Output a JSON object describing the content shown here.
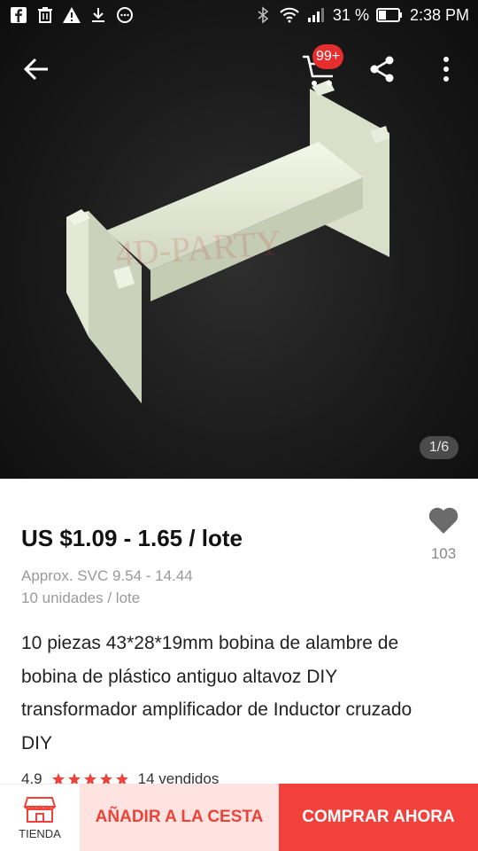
{
  "status_bar": {
    "battery": "31 %",
    "time": "2:38 PM"
  },
  "appbar": {
    "cart_badge": "99+"
  },
  "gallery": {
    "indicator": "1/6"
  },
  "product": {
    "price": "US $1.09 - 1.65 / lote",
    "approx": "Approx. SVC 9.54 - 14.44",
    "units": "10 unidades / lote",
    "wishlist_count": "103",
    "title": "10 piezas 43*28*19mm bobina de alambre de bobina de plástico antiguo altavoz DIY transformador amplificador de Inductor cruzado DIY",
    "rating": "4.9",
    "stars": 5,
    "sold": "14 vendidos"
  },
  "actions": {
    "store_label": "TIENDA",
    "add_to_cart": "AÑADIR A LA CESTA",
    "buy_now": "COMPRAR AHORA"
  },
  "colors": {
    "accent": "#f2403a",
    "badge": "#e62e2e",
    "star": "#f2403a"
  }
}
